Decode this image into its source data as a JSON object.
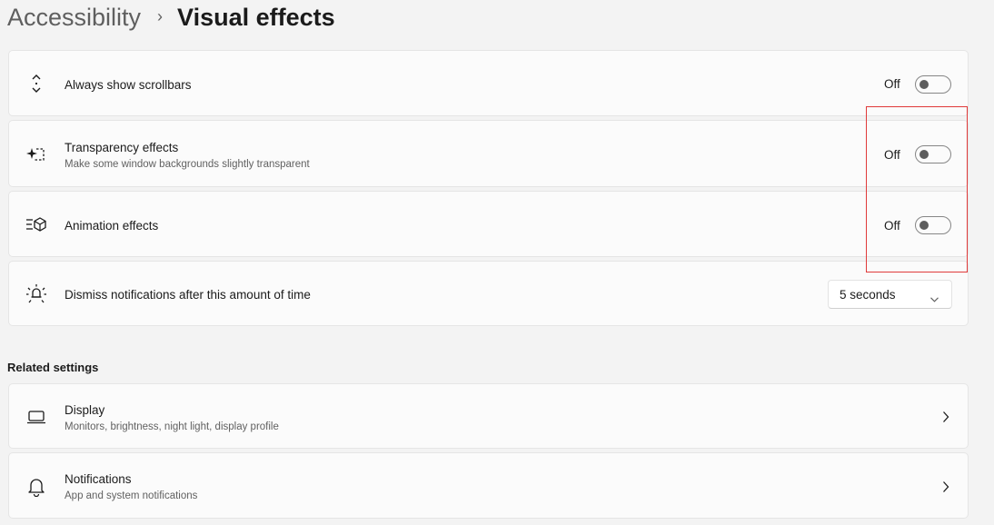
{
  "breadcrumb": {
    "parent": "Accessibility",
    "separator": "›",
    "current": "Visual effects"
  },
  "settings": [
    {
      "label": "Always show scrollbars",
      "description": "",
      "icon": "scrollbars-icon",
      "state_text": "Off",
      "on": false
    },
    {
      "label": "Transparency effects",
      "description": "Make some window backgrounds slightly transparent",
      "icon": "transparency-icon",
      "state_text": "Off",
      "on": false
    },
    {
      "label": "Animation effects",
      "description": "",
      "icon": "animation-icon",
      "state_text": "Off",
      "on": false
    },
    {
      "label": "Dismiss notifications after this amount of time",
      "description": "",
      "icon": "notification-timeout-icon",
      "dropdown_value": "5 seconds"
    }
  ],
  "related": {
    "title": "Related settings",
    "items": [
      {
        "label": "Display",
        "description": "Monitors, brightness, night light, display profile",
        "icon": "monitor-icon"
      },
      {
        "label": "Notifications",
        "description": "App and system notifications",
        "icon": "bell-icon"
      }
    ]
  },
  "colors": {
    "background": "#f3f3f3",
    "card": "#fbfbfb",
    "highlight": "#e03a3a"
  }
}
